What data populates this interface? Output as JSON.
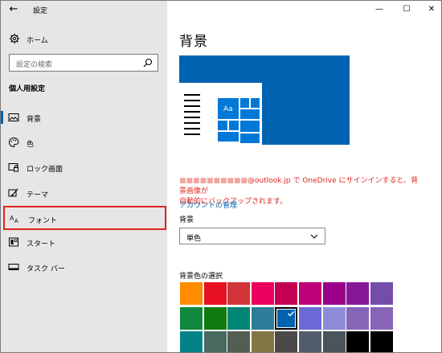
{
  "window": {
    "title": "設定",
    "back_label": "←",
    "minimize_label": "—",
    "maximize_label": "☐",
    "close_label": "✕"
  },
  "sidebar": {
    "home_label": "ホーム",
    "search_placeholder": "設定の検索",
    "section_title": "個人用設定",
    "items": [
      {
        "label": "背景",
        "icon": "picture-icon",
        "selected": true
      },
      {
        "label": "色",
        "icon": "palette-icon"
      },
      {
        "label": "ロック画面",
        "icon": "lock-screen-icon"
      },
      {
        "label": "テーマ",
        "icon": "theme-brush-icon"
      },
      {
        "label": "フォント",
        "icon": "font-icon",
        "highlighted": true
      },
      {
        "label": "スタート",
        "icon": "start-icon"
      },
      {
        "label": "タスク バー",
        "icon": "taskbar-icon"
      }
    ]
  },
  "main": {
    "title": "背景",
    "preview_sample": "Aa",
    "notice_blurred": "■■■■■■■■■■",
    "notice_line1": "@outlook.jp で OneDrive にサインインすると、背景画像が",
    "notice_line2": "自動的にバックアップされます。",
    "account_link": "アカウントの管理",
    "background_label": "背景",
    "background_value": "単色",
    "colors_label": "背景色の選択"
  },
  "colors": {
    "accent": "#0063b1",
    "highlight_border": "#e0261f",
    "swatches": [
      "#ff8c00",
      "#e81123",
      "#d13438",
      "#ea005e",
      "#c30052",
      "#bf0077",
      "#9a0089",
      "#881798",
      "#744da9",
      "#10893e",
      "#107c10",
      "#018574",
      "#2d7d9a",
      "#0063b1",
      "#6b69d6",
      "#8e8cd8",
      "#8764b8",
      "#8764b8",
      "#038387",
      "#486860",
      "#525e54",
      "#847545",
      "#4c4a48",
      "#515c6b",
      "#4a5459",
      "#000000",
      "#000000"
    ],
    "selected_index": 13
  }
}
